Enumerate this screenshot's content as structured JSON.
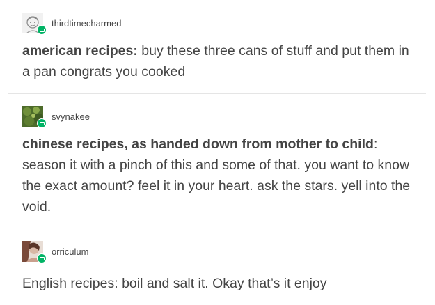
{
  "posts": [
    {
      "username": "thirdtimecharmed",
      "avatar_icon": "sketch-face-avatar-icon",
      "bold_text": "american recipes:",
      "text": " buy these three cans of stuff and put them in a pan congrats you cooked"
    },
    {
      "username": "svynakee",
      "avatar_icon": "green-foliage-avatar-icon",
      "bold_text": "chinese recipes, as handed down from mother to child",
      "text": ": season it with a pinch of this and some of that. you want to know the exact amount? feel it in your heart. ask the stars. yell into the void."
    },
    {
      "username": "orriculum",
      "avatar_icon": "person-photo-avatar-icon",
      "text": "English recipes: boil and salt it. Okay that’s it enjoy"
    }
  ],
  "badge_icon": "chat-badge-icon",
  "colors": {
    "badge": "#00b365",
    "text": "#444444",
    "divider": "#e5e5e5"
  }
}
